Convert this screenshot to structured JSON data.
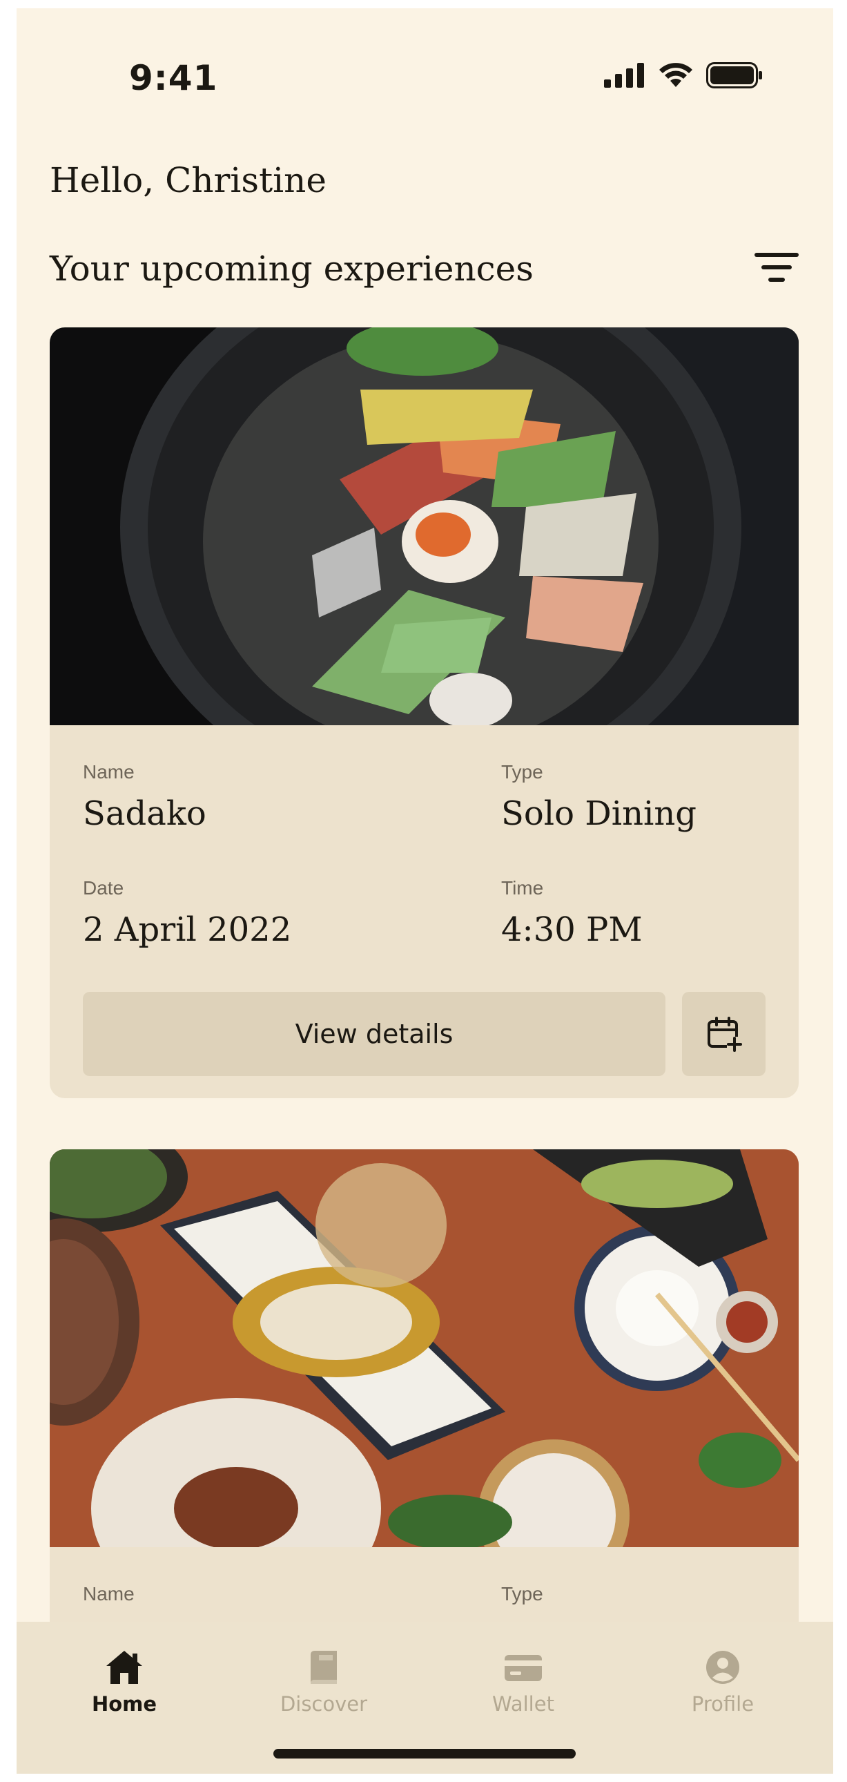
{
  "status_bar": {
    "time": "9:41"
  },
  "greeting": "Hello, Christine",
  "section_title": "Your upcoming experiences",
  "icons": {
    "filter": "filter-icon",
    "calendar_add": "calendar-add-icon",
    "signal": "cellular-signal-icon",
    "wifi": "wifi-icon",
    "battery": "battery-icon"
  },
  "experiences": [
    {
      "name_label": "Name",
      "name": "Sadako",
      "type_label": "Type",
      "type": "Solo Dining",
      "date_label": "Date",
      "date": "2 April 2022",
      "time_label": "Time",
      "time": "4:30 PM",
      "view_details": "View details"
    },
    {
      "name_label": "Name",
      "type_label": "Type"
    }
  ],
  "tabs": [
    {
      "label": "Home",
      "icon": "home-icon",
      "active": true
    },
    {
      "label": "Discover",
      "icon": "book-icon",
      "active": false
    },
    {
      "label": "Wallet",
      "icon": "wallet-icon",
      "active": false
    },
    {
      "label": "Profile",
      "icon": "profile-icon",
      "active": false
    }
  ],
  "colors": {
    "background": "#fbf3e4",
    "card": "#ede2cd",
    "button": "#ded2ba",
    "text": "#1b1812",
    "muted_label": "#6e6558",
    "inactive_tab": "#b3a891"
  }
}
